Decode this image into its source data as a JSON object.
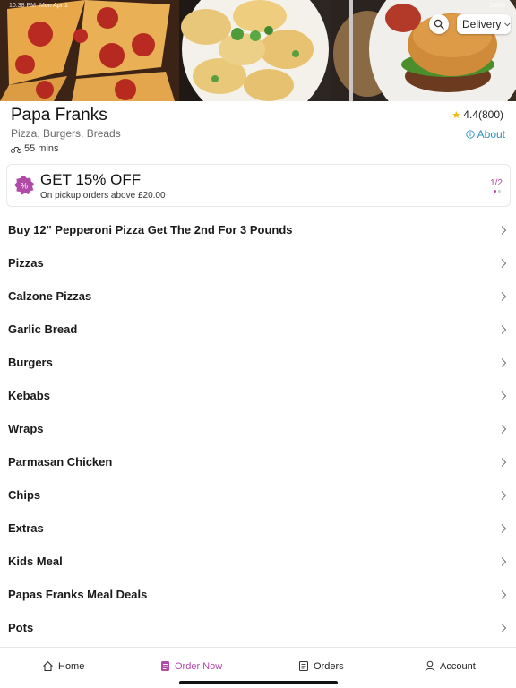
{
  "status_bar": {
    "time": "10:38 PM",
    "date": "Mon Apr 1",
    "battery": "100%"
  },
  "header": {
    "delivery_mode": "Delivery"
  },
  "restaurant": {
    "name": "Papa Franks",
    "cuisine": "Pizza, Burgers, Breads",
    "delivery_time": "55 mins",
    "rating": "4.4(800)",
    "about_label": "About"
  },
  "offer": {
    "title": "GET 15% OFF",
    "subtitle": "On pickup orders above £20.00",
    "page_indicator": "1/2",
    "badge_symbol": "%"
  },
  "menu": {
    "categories": [
      "Buy 12\" Pepperoni Pizza Get The 2nd For 3 Pounds",
      "Pizzas",
      "Calzone Pizzas",
      "Garlic Bread",
      "Burgers",
      "Kebabs",
      "Wraps",
      "Parmasan Chicken",
      "Chips",
      "Extras",
      "Kids Meal",
      "Papas Franks Meal Deals",
      "Pots"
    ]
  },
  "tabs": [
    {
      "label": "Home",
      "icon": "home-icon",
      "active": false
    },
    {
      "label": "Order Now",
      "icon": "order-icon",
      "active": true
    },
    {
      "label": "Orders",
      "icon": "receipt-icon",
      "active": false
    },
    {
      "label": "Account",
      "icon": "person-icon",
      "active": false
    }
  ],
  "colors": {
    "accent": "#b24aa8",
    "link": "#2d8fb8",
    "star": "#f5b301"
  }
}
